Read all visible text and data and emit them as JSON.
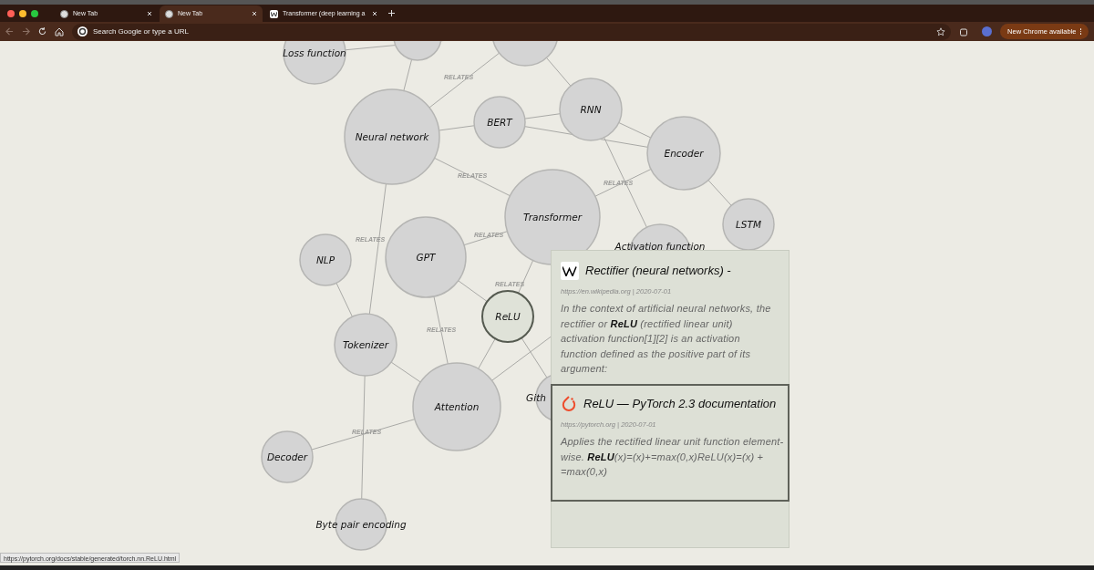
{
  "tabs": [
    {
      "title": "New Tab",
      "selected": false
    },
    {
      "title": "New Tab",
      "selected": true
    },
    {
      "title": "Transformer (deep learning a",
      "selected": false
    }
  ],
  "toolbar": {
    "address_placeholder": "Search Google or type a URL",
    "update_button": "New Chrome available"
  },
  "graph": {
    "nodes": [
      {
        "label": "Loss function",
        "selected": false
      },
      {
        "selected": false
      },
      {
        "selected": false
      },
      {
        "label": "Neural network",
        "selected": false
      },
      {
        "label": "BERT",
        "selected": false
      },
      {
        "label": "RNN",
        "selected": false
      },
      {
        "label": "Encoder",
        "selected": false
      },
      {
        "label": "Transformer",
        "selected": false
      },
      {
        "label": "LSTM",
        "selected": false
      },
      {
        "label": "Activation function",
        "selected": false
      },
      {
        "label": "NLP",
        "selected": false
      },
      {
        "label": "GPT",
        "selected": false
      },
      {
        "label": "ReLU",
        "selected": true
      },
      {
        "label": "Tokenizer",
        "selected": false
      },
      {
        "label": "Attention",
        "selected": false
      },
      {
        "label": "Gith",
        "selected": false
      },
      {
        "label": "Decoder",
        "selected": false
      },
      {
        "label": "Byte pair encoding",
        "selected": false
      }
    ],
    "edge_labels": [
      "RELATES",
      "RELATES",
      "RELATES",
      "RELATES",
      "RELATES",
      "RELATES",
      "RELATES",
      "RELATES"
    ]
  },
  "panel": {
    "results": [
      {
        "title": "Rectifier (neural networks) -",
        "meta": "https://en.wikipedia.org | 2020-07-01",
        "snippet": "In the context of artificial neural networks, the rectifier or **ReLU** (rectified linear unit) activation function[1][2] is an activation function defined as the positive part of its argument:",
        "selected": false
      },
      {
        "title": "ReLU — PyTorch 2.3 documentation",
        "meta": "https://pytorch.org | 2020-07-01",
        "snippet": "Applies the rectified linear unit function element-wise. **ReLU**(x)=(x)+=max(0,x)ReLU(x)=(x) + =max(0,x)",
        "selected": true
      }
    ]
  },
  "status_url": "https://pytorch.org/docs/stable/generated/torch.nn.ReLU.html"
}
